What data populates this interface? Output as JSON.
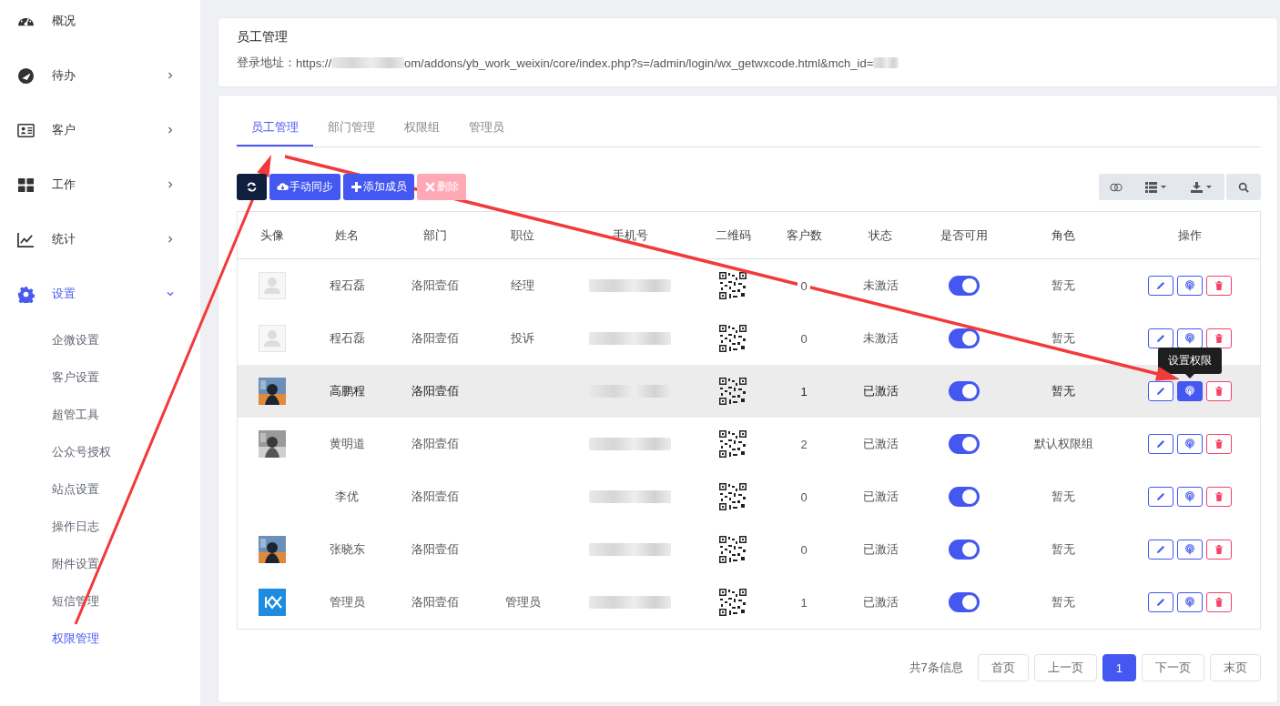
{
  "sidebar": {
    "items": [
      {
        "label": "概况",
        "kind": "gauge",
        "expandable": false,
        "selected": false
      },
      {
        "label": "待办",
        "kind": "todo",
        "expandable": true,
        "expanded": false,
        "selected": false
      },
      {
        "label": "客户",
        "kind": "card",
        "expandable": true,
        "expanded": false,
        "selected": false
      },
      {
        "label": "工作",
        "kind": "grid",
        "expandable": true,
        "expanded": false,
        "selected": false
      },
      {
        "label": "统计",
        "kind": "chart",
        "expandable": true,
        "expanded": false,
        "selected": false
      },
      {
        "label": "设置",
        "kind": "gear",
        "expandable": true,
        "expanded": true,
        "selected": true,
        "children": [
          {
            "label": "企微设置",
            "selected": false
          },
          {
            "label": "客户设置",
            "selected": false
          },
          {
            "label": "超管工具",
            "selected": false
          },
          {
            "label": "公众号授权",
            "selected": false
          },
          {
            "label": "站点设置",
            "selected": false
          },
          {
            "label": "操作日志",
            "selected": false
          },
          {
            "label": "附件设置",
            "selected": false
          },
          {
            "label": "短信管理",
            "selected": false
          },
          {
            "label": "权限管理",
            "selected": true
          }
        ]
      }
    ]
  },
  "header": {
    "title": "员工管理",
    "login_label": "登录地址：",
    "url_start": "https://",
    "url_middle": "om/addons/yb_work_weixin/core/index.php?s=/admin/login/wx_getwxcode.html&mch_id="
  },
  "tabs": [
    {
      "label": "员工管理",
      "selected": true
    },
    {
      "label": "部门管理",
      "selected": false
    },
    {
      "label": "权限组",
      "selected": false
    },
    {
      "label": "管理员",
      "selected": false
    }
  ],
  "toolbar": {
    "buttons": [
      {
        "kind": "refresh",
        "disabled": false
      },
      {
        "kind": "sync",
        "label": "手动同步",
        "disabled": false
      },
      {
        "kind": "add",
        "label": "添加成员",
        "disabled": false
      },
      {
        "kind": "delete",
        "label": "删除",
        "disabled": true
      }
    ],
    "tools": [
      {
        "kind": "toggle"
      },
      {
        "kind": "columns"
      },
      {
        "kind": "export"
      },
      {
        "kind": "search"
      }
    ]
  },
  "table": {
    "columns": [
      "头像",
      "姓名",
      "部门",
      "职位",
      "手机号",
      "二维码",
      "客户数",
      "状态",
      "是否可用",
      "角色",
      "操作"
    ],
    "rows": [
      {
        "kind": "default",
        "name": "程石磊",
        "department": "洛阳壹佰",
        "position": "经理",
        "customers": "0",
        "status": "未激活",
        "enabled": true,
        "role": "暂无",
        "hovered": false
      },
      {
        "kind": "default",
        "name": "程石磊",
        "department": "洛阳壹佰",
        "position": "投诉",
        "customers": "0",
        "status": "未激活",
        "enabled": true,
        "role": "暂无",
        "hovered": false
      },
      {
        "name": "高鹏程",
        "department": "洛阳壹佰",
        "customers": "1",
        "status": "已激活",
        "enabled": true,
        "role": "暂无",
        "hovered": true,
        "permission_tooltip": "设置权限"
      },
      {
        "name": "黄明道",
        "department": "洛阳壹佰",
        "customers": "2",
        "status": "已激活",
        "enabled": true,
        "role": "默认权限组",
        "hovered": false
      },
      {
        "kind": "none",
        "name": "李优",
        "department": "洛阳壹佰",
        "customers": "0",
        "status": "已激活",
        "enabled": true,
        "role": "暂无",
        "hovered": false
      },
      {
        "name": "张晓东",
        "department": "洛阳壹佰",
        "customers": "0",
        "status": "已激活",
        "enabled": true,
        "role": "暂无",
        "hovered": false
      },
      {
        "kind": "logo",
        "name": "管理员",
        "department": "洛阳壹佰",
        "position": "管理员",
        "customers": "1",
        "status": "已激活",
        "enabled": true,
        "role": "暂无",
        "hovered": false
      }
    ]
  },
  "pagination": {
    "summary": "共7条信息",
    "buttons": [
      {
        "label": "首页",
        "selected": false
      },
      {
        "label": "上一页",
        "selected": false
      },
      {
        "label": "1",
        "selected": true
      },
      {
        "label": "下一页",
        "selected": false
      },
      {
        "label": "末页",
        "selected": false
      }
    ]
  },
  "annotations": {
    "arrows_shown": true
  }
}
